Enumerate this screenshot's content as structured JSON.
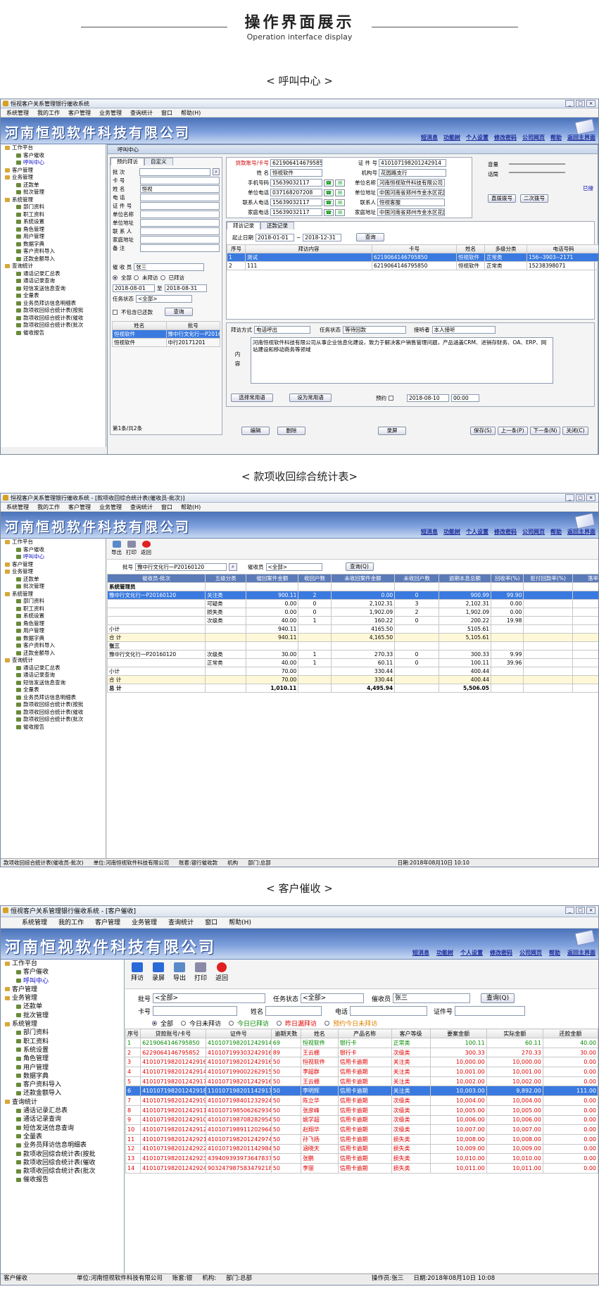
{
  "header": {
    "title": "操作界面展示",
    "subtitle": "Operation interface display"
  },
  "sections": {
    "s1": "< 呼叫中心 >",
    "s2": "< 款项收回综合统计表>",
    "s3": "< 客户催收 >"
  },
  "company": "河南恒视软件科技有限公司",
  "nav": [
    "短消息",
    "功能树",
    "个人设置",
    "修改密码",
    "公司网页",
    "帮助",
    "返回主界面"
  ],
  "win1": {
    "title": "恒视客户关系管理银行催收系统",
    "menu": [
      "系统管理",
      "我的工作",
      "客户管理",
      "业务管理",
      "查询统计",
      "窗口",
      "帮助(H)"
    ],
    "tree": [
      [
        "工作平台",
        0,
        "f"
      ],
      [
        "客户催收",
        2,
        ""
      ],
      [
        "呼叫中心",
        2,
        "s"
      ],
      [
        "客户管理",
        0,
        "f"
      ],
      [
        "业务管理",
        0,
        "f"
      ],
      [
        "还款单",
        2,
        ""
      ],
      [
        "批次管理",
        2,
        ""
      ],
      [
        "系统管理",
        0,
        "f"
      ],
      [
        "部门资料",
        2,
        ""
      ],
      [
        "职工资料",
        2,
        ""
      ],
      [
        "系统设置",
        2,
        ""
      ],
      [
        "角色管理",
        2,
        ""
      ],
      [
        "用户管理",
        2,
        ""
      ],
      [
        "数据字典",
        2,
        ""
      ],
      [
        "客户资料导入",
        2,
        ""
      ],
      [
        "还款金额导入",
        2,
        ""
      ],
      [
        "查询统计",
        0,
        "f"
      ],
      [
        "通话记录汇总表",
        2,
        ""
      ],
      [
        "通话记录查询",
        2,
        ""
      ],
      [
        "短信发送信息查询",
        2,
        ""
      ],
      [
        "全量表",
        2,
        ""
      ],
      [
        "业务员拜访信息明细表",
        2,
        ""
      ],
      [
        "款项收回综合统计表(按批",
        2,
        ""
      ],
      [
        "款项收回综合统计表(催收",
        2,
        ""
      ],
      [
        "款项收回综合统计表(批次",
        2,
        ""
      ],
      [
        "催收报告",
        2,
        ""
      ]
    ],
    "inner_title": "呼叫中心",
    "left_tabs": [
      "预约拜访",
      "自定义"
    ],
    "left_fields": [
      [
        "批    次",
        ""
      ],
      [
        "卡    号",
        ""
      ],
      [
        "姓    名",
        "恒视"
      ],
      [
        "电    话",
        ""
      ],
      [
        "证 件 号",
        ""
      ],
      [
        "单位名称",
        ""
      ],
      [
        "单位地址",
        ""
      ],
      [
        "联 系 人",
        ""
      ],
      [
        "家庭地址",
        ""
      ],
      [
        "备    注",
        ""
      ]
    ],
    "collector_label": "催 收 员",
    "collector": "张三",
    "radios": [
      "全部",
      "未拜访",
      "已拜访"
    ],
    "date_from": "2018-08-01",
    "date_to": "2018-08-31",
    "to": "至",
    "task_label": "任务状态",
    "task_value": "<全部>",
    "no_include": "不包含已还款",
    "query": "查询",
    "left_grid_head": [
      "姓名",
      "批号"
    ],
    "left_grid": [
      [
        "恒视软件",
        "豫中行文化行一P20160120"
      ],
      [
        "恒视软件",
        "中行20171201"
      ]
    ],
    "left_footer": "第1条/共2条",
    "card": {
      "acct_label": "贷款账号/卡号",
      "acct": "6219064146795850",
      "id_label": "证 件 号",
      "id": "410107198201242914",
      "name_label": "姓    名",
      "name": "恒视软件",
      "org_label": "机构号",
      "org": "花园路支行",
      "mobile_label": "手机号码",
      "mobile": "15639032117",
      "unit_label": "单位名称",
      "unit": "河南恒视软件科技有限公司",
      "uphone_label": "单位电话",
      "uphone": "037168207208",
      "uaddr_label": "单位地址",
      "uaddr": "中国河南省郑州市金水区花园路119号",
      "cphone_label": "联系人电话",
      "cphone": "15639032117",
      "contact_label": "联系人",
      "contact": "恒视客服",
      "hphone_label": "家庭电话",
      "hphone": "15639032117",
      "haddr_label": "家庭地址",
      "haddr": "中国河南省郑州市金水区花园路119号"
    },
    "side_labels": [
      "音量",
      "话筒"
    ],
    "side_btns": [
      "直拨拨号",
      "二次拨号"
    ],
    "side_status": "已接",
    "mid_tabs": [
      "拜访记录",
      "还款记录"
    ],
    "visit_date_label": "起止日期",
    "visit_from": "2018-01-01",
    "visit_to": "2018-12-31",
    "visit_head": [
      "序号",
      "拜访内容",
      "卡号",
      "姓名",
      "多级分类",
      "电话号码"
    ],
    "visit_rows": [
      [
        "1",
        "测试",
        "6219064146795850",
        "恒视软件",
        "正常类",
        "156--3903--2171"
      ],
      [
        "2",
        "111",
        "6219064146795850",
        "恒视软件",
        "正常类",
        "15238398071"
      ]
    ],
    "form": {
      "way_label": "拜访方式",
      "way": "电话呼出",
      "state_label": "任务状态",
      "state": "等待回款",
      "listener_label": "接听者",
      "listener": "本人接听",
      "content_label": "内容",
      "content": "河南恒视软件科技有限公司从事企业信息化建设，致力于解决客户销售管理问题，产品涵盖CRM、进销存财务、OA、ERP、网站建设和移动商务等领域",
      "b1": "选择常用语",
      "b2": "设为常用语",
      "appt_label": "预约",
      "appt_date": "2018-08-10",
      "appt_time": "00:00"
    },
    "bottom": {
      "edit": "编辑",
      "del": "删除",
      "rec": "录屏",
      "save": "保存(S)",
      "prev": "上一条(P)",
      "next": "下一条(N)",
      "close": "关闭(C)"
    }
  },
  "win2": {
    "title": "恒视客户关系管理银行催收系统 - [款项收回综合统计表(催收员-批次)]",
    "menu": [
      "系统管理",
      "我的工作",
      "客户管理",
      "业务管理",
      "查询统计",
      "窗口",
      "帮助(H)"
    ],
    "tools": [
      "导出",
      "打印",
      "返回"
    ],
    "batch_label": "批号",
    "batch": "豫中行文化行一P20160120",
    "collector_label": "催收员",
    "collector": "<全部>",
    "query": "查询(Q)",
    "head": [
      "催收员-批次",
      "五级分类",
      "催回案件金额",
      "收回户数",
      "未收回案件金额",
      "未收回户数",
      "逾期本息总额",
      "回收率(%)",
      "拒付回款率(%)",
      "落率"
    ],
    "rows": [
      {
        "t": "g",
        "c": [
          "系统管理员",
          "",
          "",
          "",
          "",
          "",
          "",
          "",
          "",
          ""
        ]
      },
      {
        "t": "h",
        "c": [
          "豫中行文化行一P20160120",
          "关注类",
          "900.11",
          "2",
          "0.00",
          "0",
          "900.99",
          "99.90",
          "",
          ""
        ]
      },
      {
        "t": "n",
        "c": [
          "",
          "可疑类",
          "0.00",
          "0",
          "2,102.31",
          "3",
          "2,102.31",
          "0.00",
          "",
          ""
        ]
      },
      {
        "t": "n",
        "c": [
          "",
          "损失类",
          "0.00",
          "0",
          "1,902.09",
          "2",
          "1,902.09",
          "0.00",
          "",
          ""
        ]
      },
      {
        "t": "n",
        "c": [
          "",
          "次级类",
          "40.00",
          "1",
          "160.22",
          "0",
          "200.22",
          "19.98",
          "",
          ""
        ]
      },
      {
        "t": "s",
        "c": [
          "小计",
          "",
          "940.11",
          "",
          "4165.50",
          "",
          "5105.61",
          "",
          "",
          ""
        ]
      },
      {
        "t": "y",
        "c": [
          "合   计",
          "",
          "940.11",
          "",
          "4,165.50",
          "",
          "5,105.61",
          "",
          "",
          ""
        ]
      },
      {
        "t": "g",
        "c": [
          "张三",
          "",
          "",
          "",
          "",
          "",
          "",
          "",
          "",
          ""
        ]
      },
      {
        "t": "n",
        "c": [
          "豫中行文化行一P20160120",
          "次级类",
          "30.00",
          "1",
          "270.33",
          "0",
          "300.33",
          "9.99",
          "",
          ""
        ]
      },
      {
        "t": "n",
        "c": [
          "",
          "正常类",
          "40.00",
          "1",
          "60.11",
          "0",
          "100.11",
          "39.96",
          "",
          ""
        ]
      },
      {
        "t": "s",
        "c": [
          "小计",
          "",
          "70.00",
          "",
          "330.44",
          "",
          "400.44",
          "",
          "",
          ""
        ]
      },
      {
        "t": "y",
        "c": [
          "合   计",
          "",
          "70.00",
          "",
          "330.44",
          "",
          "400.44",
          "",
          "",
          ""
        ]
      },
      {
        "t": "b",
        "c": [
          "总   计",
          "",
          "1,010.11",
          "",
          "4,495.94",
          "",
          "5,506.05",
          "",
          "",
          ""
        ]
      }
    ],
    "status": [
      "款项收回综合统计表(催收员-批次)",
      "单位:河南恒视软件科技有限公司",
      "账套:银行催收款",
      "机构",
      "部门:总部",
      "日期:2018年08月10日 10:10"
    ]
  },
  "win3": {
    "title": "恒视客户关系管理银行催收系统 - [客户催收]",
    "menu": [
      "系统管理",
      "我的工作",
      "客户管理",
      "业务管理",
      "查询统计",
      "窗口",
      "帮助(H)"
    ],
    "tools": [
      "拜访",
      "录屏",
      "导出",
      "打印",
      "返回"
    ],
    "f_batch": "批号",
    "batch": "<全部>",
    "f_state": "任务状态",
    "state": "<全部>",
    "f_col": "催收员",
    "col": "张三",
    "query": "查询(Q)",
    "f_card": "卡号",
    "f_name": "姓名",
    "f_phone": "电话",
    "f_id": "证件号",
    "radios": [
      "全部",
      "今日未拜访",
      "今日已拜访",
      "昨日漏拜访",
      "预约今日未拜访"
    ],
    "head": [
      "序号",
      "贷款账号/卡号",
      "证件号",
      "逾期天数",
      "姓名",
      "产品名称",
      "客户等级",
      "要案金额",
      "实际金额",
      "还款金额"
    ],
    "rows": [
      [
        "1",
        "6219064146795850",
        "410107198201242914",
        "69",
        "恒视软件",
        "银行卡",
        "正常类",
        "100.11",
        "60.11",
        "40.00",
        "g"
      ],
      [
        "2",
        "6229064146795852",
        "410107199303242916",
        "89",
        "王云棚",
        "银行卡",
        "次级类",
        "300.33",
        "270.33",
        "30.00",
        "r"
      ],
      [
        "3",
        "410107198201242916",
        "410107198201242916",
        "50",
        "恒视软件",
        "信用卡逾期",
        "关注类",
        "10,000.00",
        "10,000.00",
        "0.00",
        "r"
      ],
      [
        "4",
        "410107198201242914",
        "410107199002262915",
        "50",
        "李超群",
        "信用卡逾期",
        "关注类",
        "10,001.00",
        "10,001.00",
        "0.00",
        "r"
      ],
      [
        "5",
        "410107198201242917",
        "410107198201242916",
        "50",
        "王云棚",
        "信用卡逾期",
        "关注类",
        "10,002.00",
        "10,002.00",
        "0.00",
        "r"
      ],
      [
        "6",
        "410107198201242918",
        "110107198201142917",
        "50",
        "李明辉",
        "信用卡逾期",
        "关注类",
        "10,003.00",
        "9,892.00",
        "111.00",
        "h"
      ],
      [
        "7",
        "410107198201242919",
        "410107198401232924",
        "50",
        "陈立华",
        "信用卡逾期",
        "次级类",
        "10,004.00",
        "10,004.00",
        "0.00",
        "r"
      ],
      [
        "8",
        "410107198201242911",
        "410107198506262934",
        "50",
        "张彦峰",
        "信用卡逾期",
        "次级类",
        "10,005.00",
        "10,005.00",
        "0.00",
        "r"
      ],
      [
        "9",
        "410107198201242910",
        "410107198708282954",
        "50",
        "姚学超",
        "信用卡逾期",
        "次级类",
        "10,006.00",
        "10,006.00",
        "0.00",
        "r"
      ],
      [
        "10",
        "410107198201242912",
        "410107198911202964",
        "50",
        "赵翔华",
        "信用卡逾期",
        "次级类",
        "10,007.00",
        "10,007.00",
        "0.00",
        "r"
      ],
      [
        "11",
        "410107198201242921",
        "410107198201242974",
        "50",
        "孙飞扬",
        "信用卡逾期",
        "损失类",
        "10,008.00",
        "10,008.00",
        "0.00",
        "r"
      ],
      [
        "12",
        "410107198201242922",
        "410107198201142984",
        "50",
        "涵晓天",
        "信用卡逾期",
        "损失类",
        "10,009.00",
        "10,009.00",
        "0.00",
        "r"
      ],
      [
        "13",
        "410107198201242923",
        "439409393973647837",
        "50",
        "张鹏",
        "信用卡逾期",
        "损失类",
        "10,010.00",
        "10,010.00",
        "0.00",
        "r"
      ],
      [
        "14",
        "410107198201242924",
        "903247987583479218",
        "50",
        "李丽",
        "信用卡逾期",
        "损失类",
        "10,011.00",
        "10,011.00",
        "0.00",
        "r"
      ]
    ],
    "status": [
      "客户催收",
      "单位:河南恒视软件科技有限公司",
      "账套:银",
      "机构:",
      "部门:总部",
      "操作员:张三",
      "日期:2018年08月10日 10:08"
    ]
  }
}
